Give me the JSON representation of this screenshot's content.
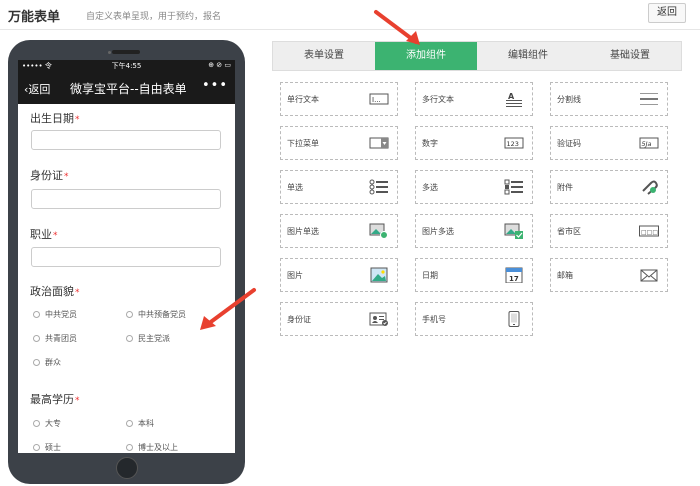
{
  "header": {
    "title": "万能表单",
    "subtitle": "自定义表单呈现，用于预约，报名",
    "back_label": "返回"
  },
  "phone": {
    "status": {
      "signal": "•••••",
      "wifi": "令",
      "time": "下午4:55",
      "icons": "⊕ ⊘ ▭"
    },
    "nav": {
      "back": "返回",
      "title": "微享宝平台--自由表单",
      "more": "•••"
    },
    "fields": [
      {
        "label": "出生日期",
        "required": "*"
      },
      {
        "label": "身份证",
        "required": "*"
      },
      {
        "label": "职业",
        "required": "*"
      },
      {
        "label": "政治面貌",
        "required": "*"
      },
      {
        "label": "最高学历",
        "required": "*"
      }
    ],
    "politics_options": [
      "中共党员",
      "中共预备党员",
      "共青团员",
      "民主党派",
      "群众"
    ],
    "education_options": [
      "大专",
      "本科",
      "硕士",
      "博士及以上"
    ]
  },
  "tabs": [
    "表单设置",
    "添加组件",
    "编辑组件",
    "基础设置"
  ],
  "active_tab": "添加组件",
  "components": [
    {
      "label": "单行文本",
      "icon": "single-line-text-icon"
    },
    {
      "label": "多行文本",
      "icon": "multi-line-text-icon"
    },
    {
      "label": "分割线",
      "icon": "divider-icon"
    },
    {
      "label": "下拉菜单",
      "icon": "dropdown-icon"
    },
    {
      "label": "数字",
      "icon": "number-icon"
    },
    {
      "label": "验证码",
      "icon": "captcha-icon"
    },
    {
      "label": "单选",
      "icon": "radio-list-icon"
    },
    {
      "label": "多选",
      "icon": "checkbox-list-icon"
    },
    {
      "label": "附件",
      "icon": "paperclip-icon"
    },
    {
      "label": "图片单选",
      "icon": "image-radio-icon"
    },
    {
      "label": "图片多选",
      "icon": "image-checkbox-icon"
    },
    {
      "label": "省市区",
      "icon": "region-icon"
    },
    {
      "label": "图片",
      "icon": "image-icon"
    },
    {
      "label": "日期",
      "icon": "calendar-icon"
    },
    {
      "label": "邮箱",
      "icon": "mail-icon"
    },
    {
      "label": "身份证",
      "icon": "id-card-icon"
    },
    {
      "label": "手机号",
      "icon": "mobile-phone-icon"
    }
  ],
  "component_icon_text": {
    "single": "I...",
    "number": "123",
    "captcha": "5Ja",
    "calendar": "17",
    "region": "□□□"
  },
  "colors": {
    "accent": "#3cb371",
    "arrow": "#e8402f",
    "phone_body": "#3c4148",
    "required": "#e33"
  }
}
